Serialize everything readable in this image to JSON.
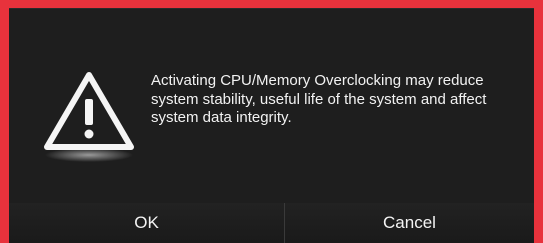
{
  "dialog": {
    "icon": "warning-triangle-icon",
    "message_lines": [
      "Activating CPU/Memory Overclocking may reduce",
      "system stability, useful life of the system and affect",
      "system data integrity."
    ],
    "ok_label": "OK",
    "cancel_label": "Cancel"
  },
  "colors": {
    "frame": "#e8323c",
    "dialog_bg": "#1e1e1e",
    "text": "#f2f2f2"
  }
}
